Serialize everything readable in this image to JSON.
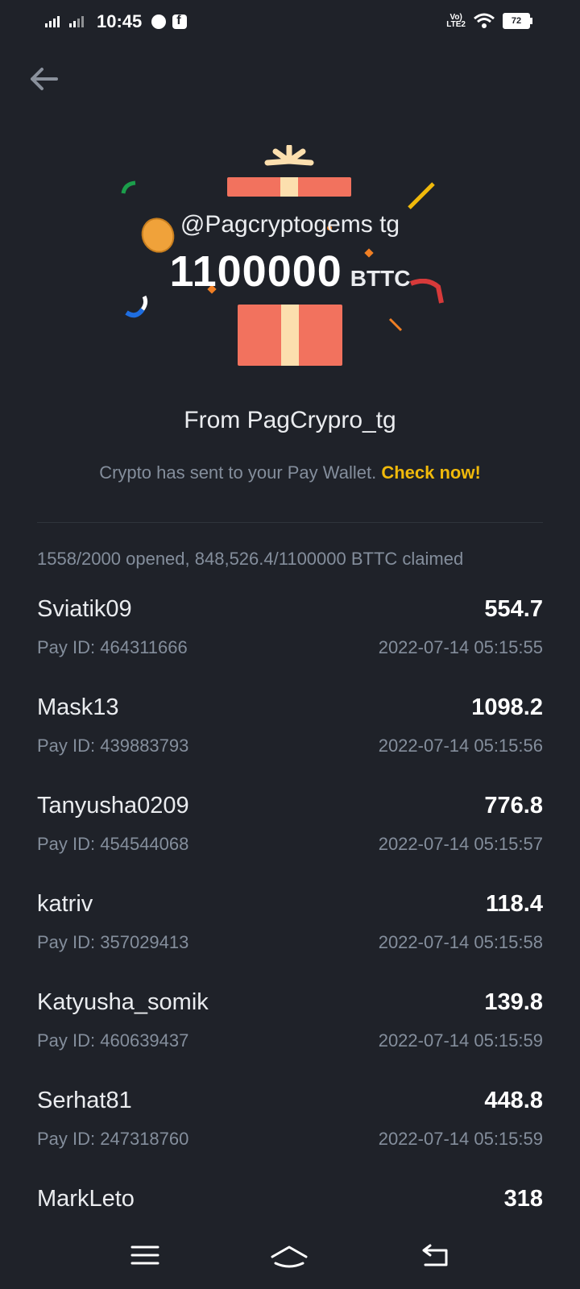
{
  "status_bar": {
    "time": "10:45",
    "network": "LTE2",
    "battery": "72"
  },
  "hero": {
    "sender_tag": "@Pagcryptogems tg",
    "amount": "1100000",
    "asset": "BTTC"
  },
  "from_line": "From PagCrypro_tg",
  "notice": {
    "text": "Crypto has sent to your Pay Wallet.",
    "link": "Check now!"
  },
  "summary": "1558/2000 opened, 848,526.4/1100000 BTTC claimed",
  "claims": [
    {
      "name": "Sviatik09",
      "amount": "554.7",
      "pay_id": "Pay ID: 464311666",
      "time": "2022-07-14 05:15:55"
    },
    {
      "name": "Mask13",
      "amount": "1098.2",
      "pay_id": "Pay ID: 439883793",
      "time": "2022-07-14 05:15:56"
    },
    {
      "name": "Tanyusha0209",
      "amount": "776.8",
      "pay_id": "Pay ID: 454544068",
      "time": "2022-07-14 05:15:57"
    },
    {
      "name": "katriv",
      "amount": "118.4",
      "pay_id": "Pay ID: 357029413",
      "time": "2022-07-14 05:15:58"
    },
    {
      "name": "Katyusha_somik",
      "amount": "139.8",
      "pay_id": "Pay ID: 460639437",
      "time": "2022-07-14 05:15:59"
    },
    {
      "name": "Serhat81",
      "amount": "448.8",
      "pay_id": "Pay ID: 247318760",
      "time": "2022-07-14 05:15:59"
    },
    {
      "name": "MarkLeto",
      "amount": "318",
      "pay_id": "",
      "time": ""
    }
  ],
  "colors": {
    "background": "#1f2229",
    "accent": "#f0b90b",
    "muted_text": "#848e9c",
    "gift": "#f2725e",
    "ribbon": "#fcdfae"
  },
  "icons": {
    "back": "arrow-left-icon",
    "nav_menu": "menu-icon",
    "nav_home": "home-icon",
    "nav_back": "return-icon"
  }
}
